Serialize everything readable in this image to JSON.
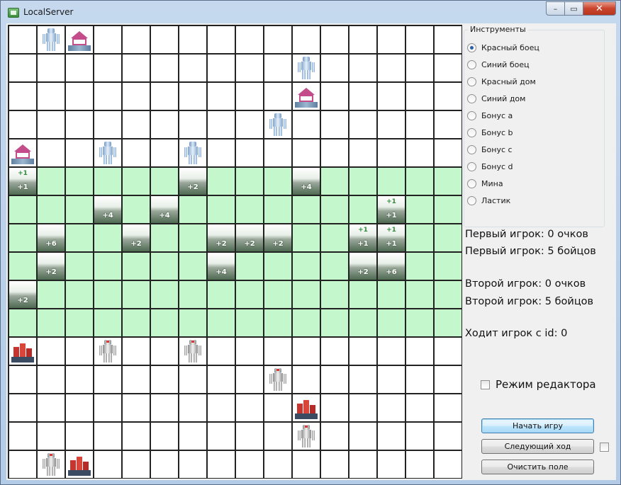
{
  "window": {
    "title": "LocalServer"
  },
  "tools": {
    "title": "Инструменты",
    "items": [
      {
        "label": "Красный боец",
        "checked": true
      },
      {
        "label": "Синий боец",
        "checked": false
      },
      {
        "label": "Красный дом",
        "checked": false
      },
      {
        "label": "Синий дом",
        "checked": false
      },
      {
        "label": "Бонус a",
        "checked": false
      },
      {
        "label": "Бонус b",
        "checked": false
      },
      {
        "label": "Бонус c",
        "checked": false
      },
      {
        "label": "Бонус d",
        "checked": false
      },
      {
        "label": "Мина",
        "checked": false
      },
      {
        "label": "Ластик",
        "checked": false
      }
    ]
  },
  "stats": {
    "p1_score": "Первый игрок: 0 очков",
    "p1_fighters": "Первый игрок: 5 бойцов",
    "p2_score": "Второй игрок: 0 очков",
    "p2_fighters": "Второй игрок: 5 бойцов",
    "turn": "Ходит игрок с id: 0"
  },
  "editor_mode": {
    "label": "Режим редактора",
    "checked": false
  },
  "buttons": {
    "start": "Начать игру",
    "next": "Следующий ход",
    "clear": "Очистить поле"
  },
  "board": {
    "size": 16,
    "green_rows": [
      5,
      6,
      7,
      8,
      9,
      10
    ],
    "pieces": [
      {
        "r": 0,
        "c": 1,
        "type": "fighter-blue"
      },
      {
        "r": 0,
        "c": 2,
        "type": "house-blue"
      },
      {
        "r": 1,
        "c": 10,
        "type": "fighter-blue"
      },
      {
        "r": 2,
        "c": 10,
        "type": "house-blue"
      },
      {
        "r": 3,
        "c": 9,
        "type": "fighter-blue"
      },
      {
        "r": 4,
        "c": 0,
        "type": "house-blue"
      },
      {
        "r": 4,
        "c": 3,
        "type": "fighter-blue"
      },
      {
        "r": 4,
        "c": 6,
        "type": "fighter-blue"
      },
      {
        "r": 5,
        "c": 0,
        "type": "bonus",
        "top": "+1",
        "text": "+1"
      },
      {
        "r": 5,
        "c": 6,
        "type": "bonus",
        "text": "+2"
      },
      {
        "r": 5,
        "c": 10,
        "type": "bonus",
        "text": "+4"
      },
      {
        "r": 6,
        "c": 3,
        "type": "bonus",
        "text": "+4"
      },
      {
        "r": 6,
        "c": 5,
        "type": "bonus",
        "text": "+4"
      },
      {
        "r": 6,
        "c": 13,
        "type": "bonus",
        "top": "+1",
        "text": "+1"
      },
      {
        "r": 7,
        "c": 1,
        "type": "bonus",
        "text": "+6"
      },
      {
        "r": 7,
        "c": 4,
        "type": "bonus",
        "text": "+2"
      },
      {
        "r": 7,
        "c": 7,
        "type": "bonus",
        "text": "+2"
      },
      {
        "r": 7,
        "c": 8,
        "type": "bonus",
        "text": "+2"
      },
      {
        "r": 7,
        "c": 9,
        "type": "bonus",
        "text": "+2"
      },
      {
        "r": 7,
        "c": 12,
        "type": "bonus",
        "top": "+1",
        "text": "+1"
      },
      {
        "r": 7,
        "c": 13,
        "type": "bonus",
        "top": "+1",
        "text": "+1"
      },
      {
        "r": 8,
        "c": 1,
        "type": "bonus",
        "text": "+2"
      },
      {
        "r": 8,
        "c": 7,
        "type": "bonus",
        "text": "+4"
      },
      {
        "r": 8,
        "c": 12,
        "type": "bonus",
        "text": "+2"
      },
      {
        "r": 8,
        "c": 13,
        "type": "bonus",
        "text": "+6"
      },
      {
        "r": 9,
        "c": 0,
        "type": "bonus",
        "text": "+2"
      },
      {
        "r": 11,
        "c": 0,
        "type": "house-red"
      },
      {
        "r": 11,
        "c": 3,
        "type": "fighter-red"
      },
      {
        "r": 11,
        "c": 6,
        "type": "fighter-red"
      },
      {
        "r": 12,
        "c": 9,
        "type": "fighter-red"
      },
      {
        "r": 13,
        "c": 10,
        "type": "house-red"
      },
      {
        "r": 14,
        "c": 10,
        "type": "fighter-red"
      },
      {
        "r": 15,
        "c": 1,
        "type": "fighter-red"
      },
      {
        "r": 15,
        "c": 2,
        "type": "house-red"
      }
    ]
  }
}
